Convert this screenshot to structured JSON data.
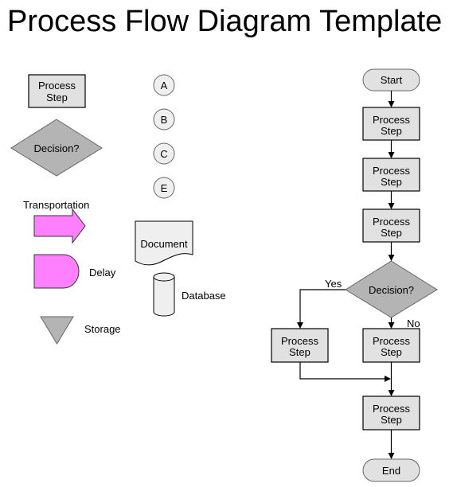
{
  "title": "Process Flow Diagram Template",
  "legend": {
    "process": {
      "line1": "Process",
      "line2": "Step"
    },
    "decision": "Decision?",
    "connectors": [
      "A",
      "B",
      "C",
      "E"
    ],
    "transportation": "Transportation",
    "document": "Document",
    "delay": "Delay",
    "database": "Database",
    "storage": "Storage"
  },
  "flow": {
    "start": "Start",
    "steps": [
      {
        "line1": "Process",
        "line2": "Step"
      },
      {
        "line1": "Process",
        "line2": "Step"
      },
      {
        "line1": "Process",
        "line2": "Step"
      }
    ],
    "decision": "Decision?",
    "yes_label": "Yes",
    "no_label": "No",
    "yes_step": {
      "line1": "Process",
      "line2": "Step"
    },
    "no_step": {
      "line1": "Process",
      "line2": "Step"
    },
    "merge_step": {
      "line1": "Process",
      "line2": "Step"
    },
    "end": "End"
  },
  "colors": {
    "process_fill": "#e1e1e1",
    "decision_fill": "#b4b4b4",
    "pink_fill": "#ff80ff"
  }
}
